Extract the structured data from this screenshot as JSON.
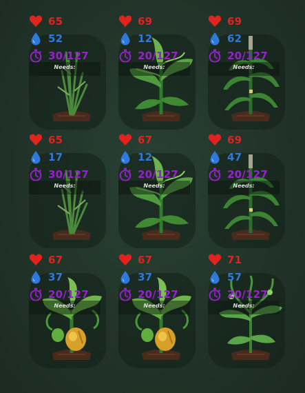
{
  "labels": {
    "needs": "Needs:"
  },
  "colors": {
    "health": "#e0231e",
    "water": "#2f78dc",
    "time": "#9a1fd0"
  },
  "plants": [
    {
      "health": "65",
      "water": "52",
      "time": "30/127",
      "type": "reed"
    },
    {
      "health": "69",
      "water": "12",
      "time": "20/127",
      "type": "leafy"
    },
    {
      "health": "69",
      "water": "62",
      "time": "20/127",
      "type": "corn"
    },
    {
      "health": "65",
      "water": "17",
      "time": "30/127",
      "type": "reed"
    },
    {
      "health": "67",
      "water": "12",
      "time": "20/127",
      "type": "leafy"
    },
    {
      "health": "69",
      "water": "47",
      "time": "20/127",
      "type": "corn"
    },
    {
      "health": "67",
      "water": "37",
      "time": "20/127",
      "type": "squash"
    },
    {
      "health": "67",
      "water": "37",
      "time": "20/127",
      "type": "squash"
    },
    {
      "health": "71",
      "water": "57",
      "time": "20/127",
      "type": "vine"
    }
  ]
}
